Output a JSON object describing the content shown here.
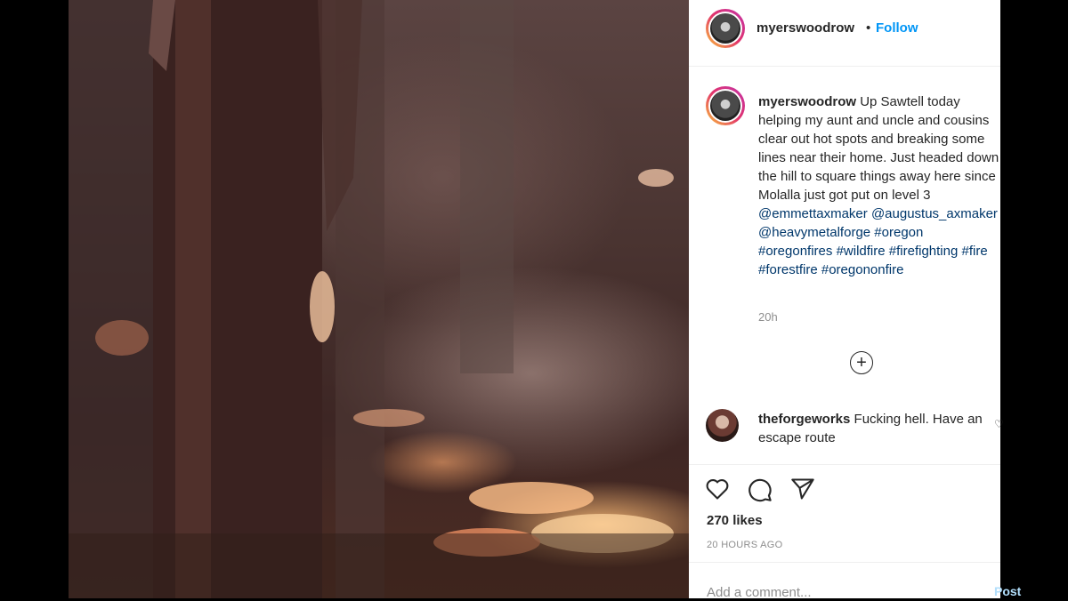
{
  "post": {
    "username": "myerswoodrow",
    "dot": "•",
    "follow_label": "Follow",
    "caption_text": "Up Sawtell today helping my aunt and uncle and cousins clear out hot spots and breaking some lines near their home. Just headed down the hill to square things away here since Molalla just got put on level 3",
    "caption_tags": [
      "@emmettaxmaker",
      "@augustus_axmaker",
      "@heavymetalforge",
      "#oregon",
      "#oregonfires",
      "#wildfire",
      "#firefighting",
      "#fire",
      "#forestfire",
      "#oregononfire"
    ],
    "caption_time": "20h",
    "likes": "270 likes",
    "posted": "20 HOURS AGO"
  },
  "comment": {
    "username": "theforgeworks",
    "text": "Fucking hell. Have an escape route"
  },
  "add_comment": {
    "placeholder": "Add a comment...",
    "post_label": "Post"
  },
  "icons": {
    "next": "chevron-right-icon",
    "load_more": "plus-circle-icon",
    "like": "heart-icon",
    "comment": "speech-bubble-icon",
    "share": "paper-plane-icon",
    "comment_like": "small-heart-icon"
  },
  "colors": {
    "link": "#0095f6",
    "mention": "#00376b",
    "muted": "#8e8e8e"
  }
}
